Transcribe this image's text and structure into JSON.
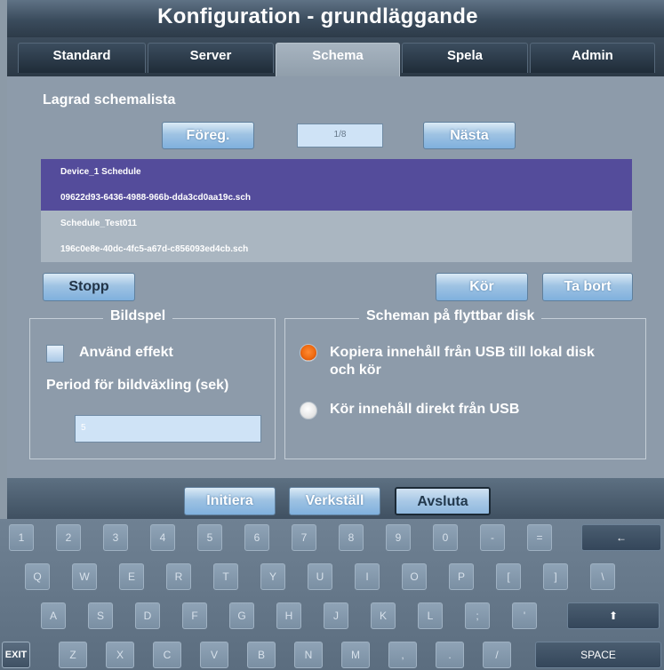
{
  "window": {
    "title": "Konfiguration - grundläggande"
  },
  "tabs": [
    {
      "label": "Standard",
      "active": false
    },
    {
      "label": "Server",
      "active": false
    },
    {
      "label": "Schema",
      "active": true
    },
    {
      "label": "Spela",
      "active": false
    },
    {
      "label": "Admin",
      "active": false
    }
  ],
  "schedule": {
    "title": "Lagrad schemalista",
    "prev_label": "Föreg.",
    "page": "1/8",
    "next_label": "Nästa",
    "items": [
      {
        "name": "Device_1 Schedule",
        "file": "09622d93-6436-4988-966b-dda3cd0aa19c.sch",
        "selected": true
      },
      {
        "name": "Schedule_Test011",
        "file": "196c0e8e-40dc-4fc5-a67d-c856093ed4cb.sch",
        "selected": false
      }
    ],
    "stop_label": "Stopp",
    "run_label": "Kör",
    "delete_label": "Ta bort"
  },
  "slideshow": {
    "legend": "Bildspel",
    "use_effect_label": "Använd effekt",
    "use_effect_checked": false,
    "period_label": "Period för bildväxling (sek)",
    "period_value": "5"
  },
  "usb": {
    "legend": "Scheman på flyttbar disk",
    "option_copy": "Kopiera innehåll från USB till lokal disk och kör",
    "option_direct": "Kör innehåll direkt från USB",
    "selected": "copy"
  },
  "footer": {
    "init_label": "Initiera",
    "apply_label": "Verkställ",
    "exit_label": "Avsluta"
  },
  "keyboard": {
    "row1": [
      "1",
      "2",
      "3",
      "4",
      "5",
      "6",
      "7",
      "8",
      "9",
      "0",
      "-",
      "=",
      "←"
    ],
    "row2": [
      "Q",
      "W",
      "E",
      "R",
      "T",
      "Y",
      "U",
      "I",
      "O",
      "P",
      "[",
      "]",
      "\\"
    ],
    "row3": [
      "A",
      "S",
      "D",
      "F",
      "G",
      "H",
      "J",
      "K",
      "L",
      ";",
      "'",
      "⬆"
    ],
    "row4": [
      "EXIT",
      "Z",
      "X",
      "C",
      "V",
      "B",
      "N",
      "M",
      ",",
      ".",
      "/",
      "SPACE"
    ]
  },
  "colors": {
    "selected_row": "#544c9b",
    "radio_on": "#ef6a10",
    "button_blue": "#8fb8de"
  }
}
